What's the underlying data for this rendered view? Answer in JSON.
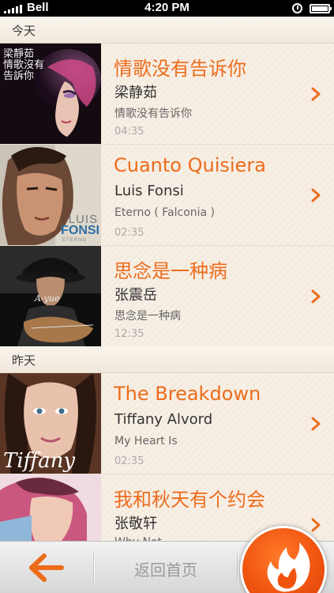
{
  "status_bar": {
    "carrier": "Bell",
    "time": "4:20 PM"
  },
  "sections": [
    {
      "label": "今天"
    },
    {
      "label": "昨天"
    }
  ],
  "songs": [
    {
      "title": "情歌没有告诉你",
      "artist": "梁静茹",
      "album": "情歌没有告诉你",
      "duration": "04:35"
    },
    {
      "title": "Cuanto Quisiera",
      "artist": "Luis Fonsi",
      "album": "Eterno ( Falconia )",
      "duration": "02:35"
    },
    {
      "title": "思念是一种病",
      "artist": "张震岳",
      "album": "思念是一种病",
      "duration": "12:35"
    },
    {
      "title": "The Breakdown",
      "artist": "Tiffany Alvord",
      "album": "My Heart Is",
      "duration": "02:35"
    },
    {
      "title": "我和秋天有个约会",
      "artist": "张敬轩",
      "album": "Why Not",
      "duration": ""
    }
  ],
  "covers": {
    "cover1": {
      "text_lines": [
        "梁靜茹",
        "情歌沒有",
        "告訴你"
      ]
    },
    "cover2": {
      "line1": "LUIS",
      "line2": "FONSI",
      "line3": "ETERNO"
    },
    "cover3": {
      "script": "A-yue"
    },
    "cover4": {
      "script": "Tiffany"
    }
  },
  "bottom_bar": {
    "home_label": "返回首页"
  },
  "colors": {
    "accent": "#ec6c1c",
    "background": "#f7efe6",
    "fire": "#f0530f"
  }
}
